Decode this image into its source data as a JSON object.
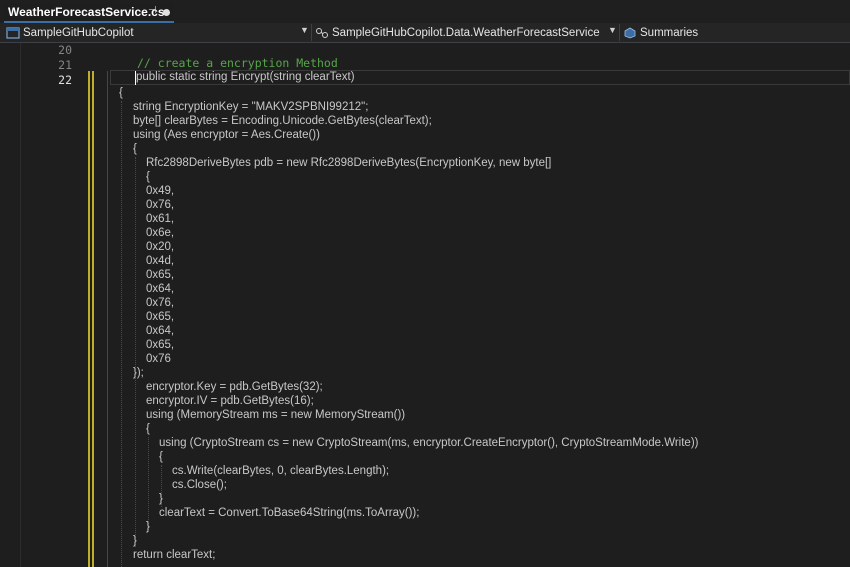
{
  "tab": {
    "title": "WeatherForecastService.cs",
    "pin_glyph": "⊣",
    "modified_indicator": "dirty-dot"
  },
  "navbar": {
    "project": "SampleGitHubCopilot",
    "type": "SampleGitHubCopilot.Data.WeatherForecastService",
    "member": "Summaries",
    "project_icon": "csharp-project-icon",
    "type_icon": "class-icon",
    "member_icon": "field-icon"
  },
  "editor": {
    "line_numbers": [
      "20",
      "21",
      "22"
    ],
    "comment": "// create a encryption Method",
    "lines": [
      "public static string Encrypt(string clearText)",
      "{",
      "string EncryptionKey = \"MAKV2SPBNI99212\";",
      "byte[] clearBytes = Encoding.Unicode.GetBytes(clearText);",
      "using (Aes encryptor = Aes.Create())",
      "{",
      "Rfc2898DeriveBytes pdb = new Rfc2898DeriveBytes(EncryptionKey, new byte[]",
      "{",
      "0x49,",
      "0x76,",
      "0x61,",
      "0x6e,",
      "0x20,",
      "0x4d,",
      "0x65,",
      "0x64,",
      "0x76,",
      "0x65,",
      "0x64,",
      "0x65,",
      "0x76",
      "});",
      "encryptor.Key = pdb.GetBytes(32);",
      "encryptor.IV = pdb.GetBytes(16);",
      "using (MemoryStream ms = new MemoryStream())",
      "{",
      "using (CryptoStream cs = new CryptoStream(ms, encryptor.CreateEncryptor(), CryptoStreamMode.Write))",
      "{",
      "cs.Write(clearBytes, 0, clearBytes.Length);",
      "cs.Close();",
      "}",
      "clearText = Convert.ToBase64String(ms.ToArray());",
      "}",
      "}",
      "return clearText;"
    ]
  },
  "colors": {
    "background": "#1e1e1e",
    "comment": "#57a64a",
    "text": "#c8c8c8",
    "change_bar": "#bfae2c"
  }
}
